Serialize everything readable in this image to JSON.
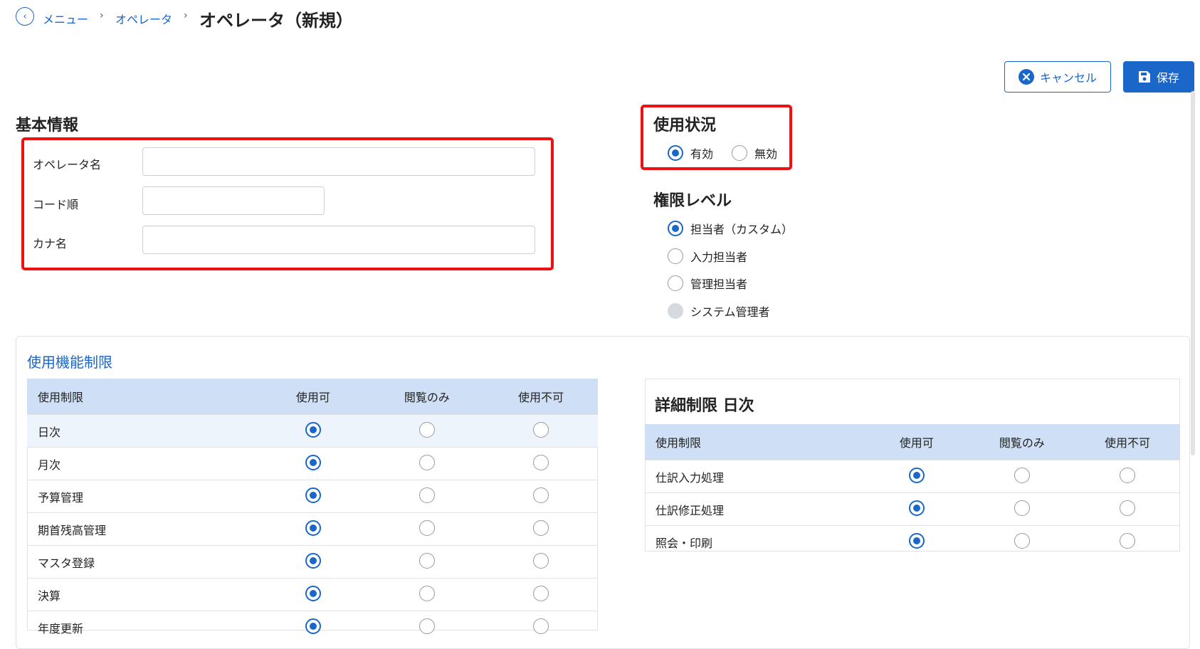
{
  "breadcrumb": {
    "items": [
      "メニュー",
      "オペレータ"
    ],
    "separator": "›",
    "current": "オペレータ（新規）"
  },
  "actions": {
    "cancel_label": "キャンセル",
    "save_label": "保存"
  },
  "basic_info": {
    "title": "基本情報",
    "fields": [
      {
        "label": "オペレータ名",
        "value": ""
      },
      {
        "label": "コード順",
        "value": ""
      },
      {
        "label": "カナ名",
        "value": ""
      }
    ]
  },
  "usage_status": {
    "title": "使用状況",
    "options": [
      {
        "label": "有効",
        "selected": true
      },
      {
        "label": "無効",
        "selected": false
      }
    ]
  },
  "permission_level": {
    "title": "権限レベル",
    "options": [
      {
        "label": "担当者（カスタム）",
        "selected": true,
        "disabled": false
      },
      {
        "label": "入力担当者",
        "selected": false,
        "disabled": false
      },
      {
        "label": "管理担当者",
        "selected": false,
        "disabled": false
      },
      {
        "label": "システム管理者",
        "selected": false,
        "disabled": true
      }
    ]
  },
  "function_restrictions": {
    "title": "使用機能制限",
    "headers": [
      "使用制限",
      "使用可",
      "閲覧のみ",
      "使用不可"
    ],
    "rows": [
      {
        "name": "日次",
        "selected": 0,
        "highlighted": true
      },
      {
        "name": "月次",
        "selected": 0
      },
      {
        "name": "予算管理",
        "selected": 0
      },
      {
        "name": "期首残高管理",
        "selected": 0
      },
      {
        "name": "マスタ登録",
        "selected": 0
      },
      {
        "name": "決算",
        "selected": 0
      },
      {
        "name": "年度更新",
        "selected": 0
      }
    ]
  },
  "detail_restrictions": {
    "title": "詳細制限 日次",
    "headers": [
      "使用制限",
      "使用可",
      "閲覧のみ",
      "使用不可"
    ],
    "rows": [
      {
        "name": "仕訳入力処理",
        "selected": 0
      },
      {
        "name": "仕訳修正処理",
        "selected": 0
      },
      {
        "name": "照会・印刷",
        "selected": 0
      }
    ]
  },
  "colors": {
    "accent": "#1a66c9",
    "highlight_box": "#ee1111",
    "table_header": "#cfe0f6"
  }
}
